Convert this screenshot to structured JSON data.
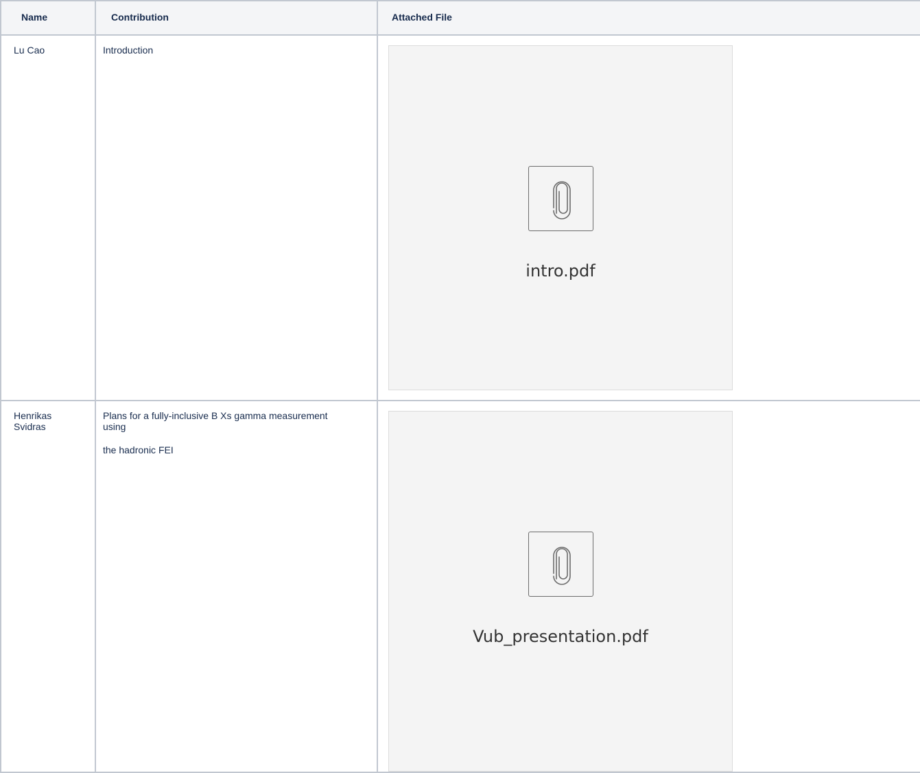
{
  "table": {
    "headers": [
      "Name",
      "Contribution",
      "Attached File"
    ],
    "rows": [
      {
        "name_lines": [
          "Lu Cao"
        ],
        "contribution_paragraphs": [
          "Introduction"
        ],
        "file": {
          "name": "intro.pdf",
          "icon": "paperclip-icon"
        }
      },
      {
        "name_lines": [
          "Henrikas",
          "Svidras"
        ],
        "contribution_paragraphs": [
          "Plans for a fully-inclusive B Xs gamma measurement using",
          "the hadronic FEI"
        ],
        "file": {
          "name": "Vub_presentation.pdf",
          "icon": "paperclip-icon"
        }
      }
    ]
  },
  "colors": {
    "header_bg": "#f4f5f7",
    "border": "#c1c7d0",
    "preview_bg": "#f4f4f4",
    "text": "#172b4d"
  }
}
